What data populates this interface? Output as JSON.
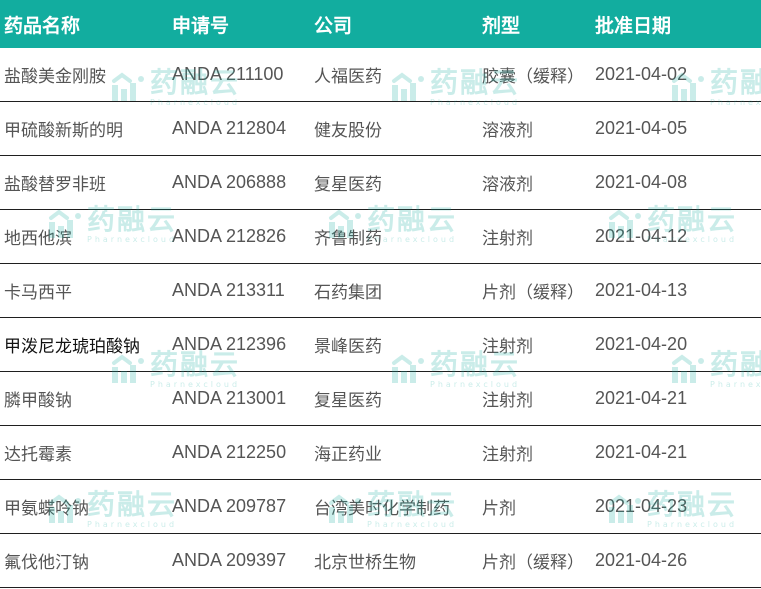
{
  "header": [
    "药品名称",
    "申请号",
    "公司",
    "剂型",
    "批准日期"
  ],
  "rows": [
    {
      "drug": "盐酸美金刚胺",
      "anda": "ANDA 211100",
      "company": "人福医药",
      "form": "胶囊（缓释）",
      "date": "2021-04-02"
    },
    {
      "drug": "甲硫酸新斯的明",
      "anda": "ANDA 212804",
      "company": "健友股份",
      "form": "溶液剂",
      "date": "2021-04-05"
    },
    {
      "drug": "盐酸替罗非班",
      "anda": "ANDA 206888",
      "company": "复星医药",
      "form": "溶液剂",
      "date": "2021-04-08"
    },
    {
      "drug": "地西他滨",
      "anda": "ANDA 212826",
      "company": "齐鲁制药",
      "form": "注射剂",
      "date": "2021-04-12"
    },
    {
      "drug": "卡马西平",
      "anda": "ANDA 213311",
      "company": "石药集团",
      "form": "片剂（缓释）",
      "date": "2021-04-13"
    },
    {
      "drug": "甲泼尼龙琥珀酸钠",
      "anda": "ANDA 212396",
      "company": "景峰医药",
      "form": "注射剂",
      "date": "2021-04-20"
    },
    {
      "drug": "膦甲酸钠",
      "anda": "ANDA 213001",
      "company": "复星医药",
      "form": "注射剂",
      "date": "2021-04-21"
    },
    {
      "drug": "达托霉素",
      "anda": "ANDA 212250",
      "company": "海正药业",
      "form": "注射剂",
      "date": "2021-04-21"
    },
    {
      "drug": "甲氨蝶呤钠",
      "anda": "ANDA 209787",
      "company": "台湾美时化学制药",
      "form": "片剂",
      "date": "2021-04-23"
    },
    {
      "drug": "氟伐他汀钠",
      "anda": "ANDA 209397",
      "company": "北京世桥生物",
      "form": "片剂（缓释）",
      "date": "2021-04-26"
    }
  ],
  "watermark": {
    "main": "药融云",
    "sub": "Pharnexcloud"
  },
  "colors": {
    "header_bg": "#12ad9f",
    "watermark": "#12ad9f"
  }
}
